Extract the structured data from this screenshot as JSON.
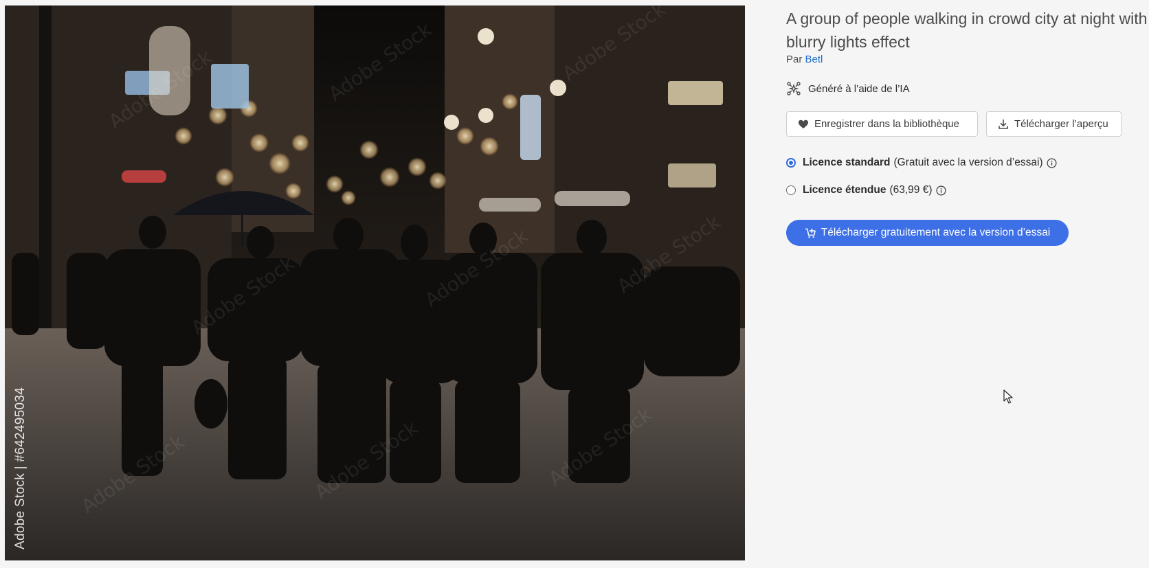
{
  "image": {
    "watermark_id": "Adobe Stock | #642495034",
    "watermark_brand": "Adobe Stock"
  },
  "asset": {
    "title": "A group of people walking in crowd city at night with blurry lights effect",
    "author_prefix": "Par",
    "author_name": "Betl",
    "ai_label": "Généré à l’aide de l’IA"
  },
  "actions": {
    "save_label": "Enregistrer dans la bibliothèque",
    "preview_label": "Télécharger l’aperçu"
  },
  "licenses": [
    {
      "name": "Licence standard",
      "detail": "(Gratuit avec la version d’essai)",
      "selected": true
    },
    {
      "name": "Licence étendue",
      "detail": "(63,99 €)",
      "selected": false
    }
  ],
  "cta": {
    "label": "Télécharger gratuitement avec la version d’essai",
    "color": "#3d6fe6"
  },
  "colors": {
    "accent": "#3d6fe6",
    "link": "#1f6fd0",
    "background": "#f5f5f5"
  }
}
